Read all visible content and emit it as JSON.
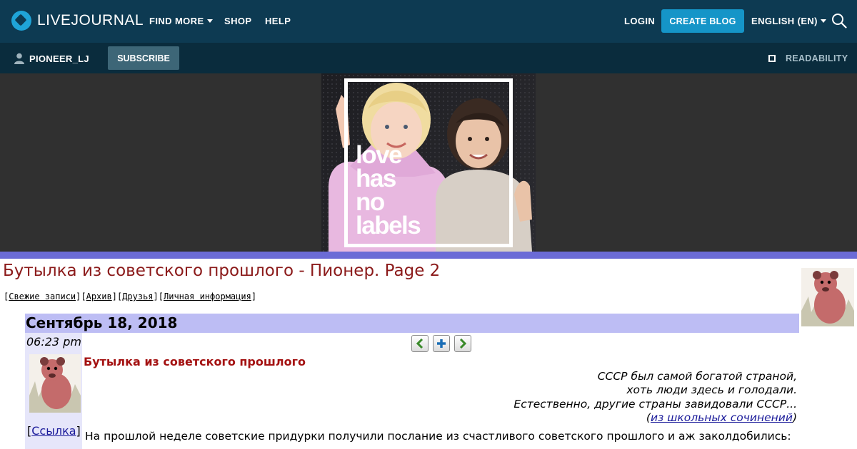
{
  "header": {
    "logo_text": "LIVEJOURNAL",
    "find_more": "FIND MORE",
    "shop": "SHOP",
    "help": "HELP",
    "login": "LOGIN",
    "create_blog": "CREATE BLOG",
    "language": "ENGLISH (EN)"
  },
  "subbar": {
    "username": "PIONEER_LJ",
    "subscribe": "SUBSCRIBE",
    "readability": "READABILITY"
  },
  "banner_ad": {
    "text_line1": "love",
    "text_line2": "has",
    "text_line3": "no",
    "text_line4": "labels"
  },
  "journal": {
    "title": "Бутылка из советского прошлого - Пионер. Page 2",
    "nav": [
      "Свежие записи",
      "Архив",
      "Друзья",
      "Личная информация"
    ]
  },
  "entry": {
    "date": "Сентябрь 18, 2018",
    "time": "06:23 pm",
    "link_label": "Ссылка",
    "title": "Бутылка из советского прошлого",
    "epigraph": [
      "СССР был самой богатой страной,",
      "хоть люди здесь и голодали.",
      "Естественно, другие страны завидовали СССР..."
    ],
    "epigraph_source": "из школьных сочинений",
    "body": "На прошлой неделе советские придурки получили послание из счастливого советского прошлого и аж заколдобились:"
  },
  "colors": {
    "topbar": "#0d3a52",
    "subbar": "#0a2c3d",
    "accent_button": "#1595c8",
    "banner_bg": "#303030",
    "accent_bar": "#6b6bd6",
    "date_bar": "#bdbdf4",
    "title_red": "#8b1a1a"
  }
}
